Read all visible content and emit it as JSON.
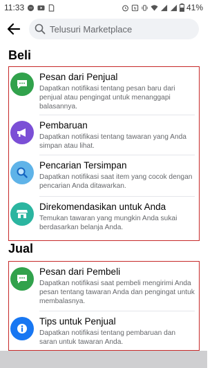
{
  "status_bar": {
    "time": "11:33",
    "battery": "41%"
  },
  "search": {
    "placeholder": "Telusuri Marketplace"
  },
  "sections": [
    {
      "title": "Beli",
      "items": [
        {
          "title": "Pesan dari Penjual",
          "desc": "Dapatkan notifikasi tentang pesan baru dari penjual atau pengingat untuk menanggapi balasannya.",
          "icon": "chat-bubble-icon",
          "color": "#31a24c"
        },
        {
          "title": "Pembaruan",
          "desc": "Dapatkan notifikasi tentang tawaran yang Anda simpan atau lihat.",
          "icon": "megaphone-icon",
          "color": "#7b4fd6"
        },
        {
          "title": "Pencarian Tersimpan",
          "desc": "Dapatkan notifikasi saat item yang cocok dengan pencarian Anda ditawarkan.",
          "icon": "search-icon",
          "color": "#5fb3e8"
        },
        {
          "title": "Direkomendasikan untuk Anda",
          "desc": "Temukan tawaran yang mungkin Anda sukai berdasarkan belanja Anda.",
          "icon": "shop-icon",
          "color": "#2bb5a0"
        }
      ]
    },
    {
      "title": "Jual",
      "items": [
        {
          "title": "Pesan dari Pembeli",
          "desc": "Dapatkan notifikasi saat pembeli mengirimi Anda pesan tentang tawaran Anda dan pengingat untuk membalasnya.",
          "icon": "chat-bubble-icon",
          "color": "#31a24c"
        },
        {
          "title": "Tips untuk Penjual",
          "desc": "Dapatkan notifikasi tentang pembaruan dan saran untuk tawaran Anda.",
          "icon": "info-icon",
          "color": "#1877f2"
        }
      ]
    }
  ]
}
